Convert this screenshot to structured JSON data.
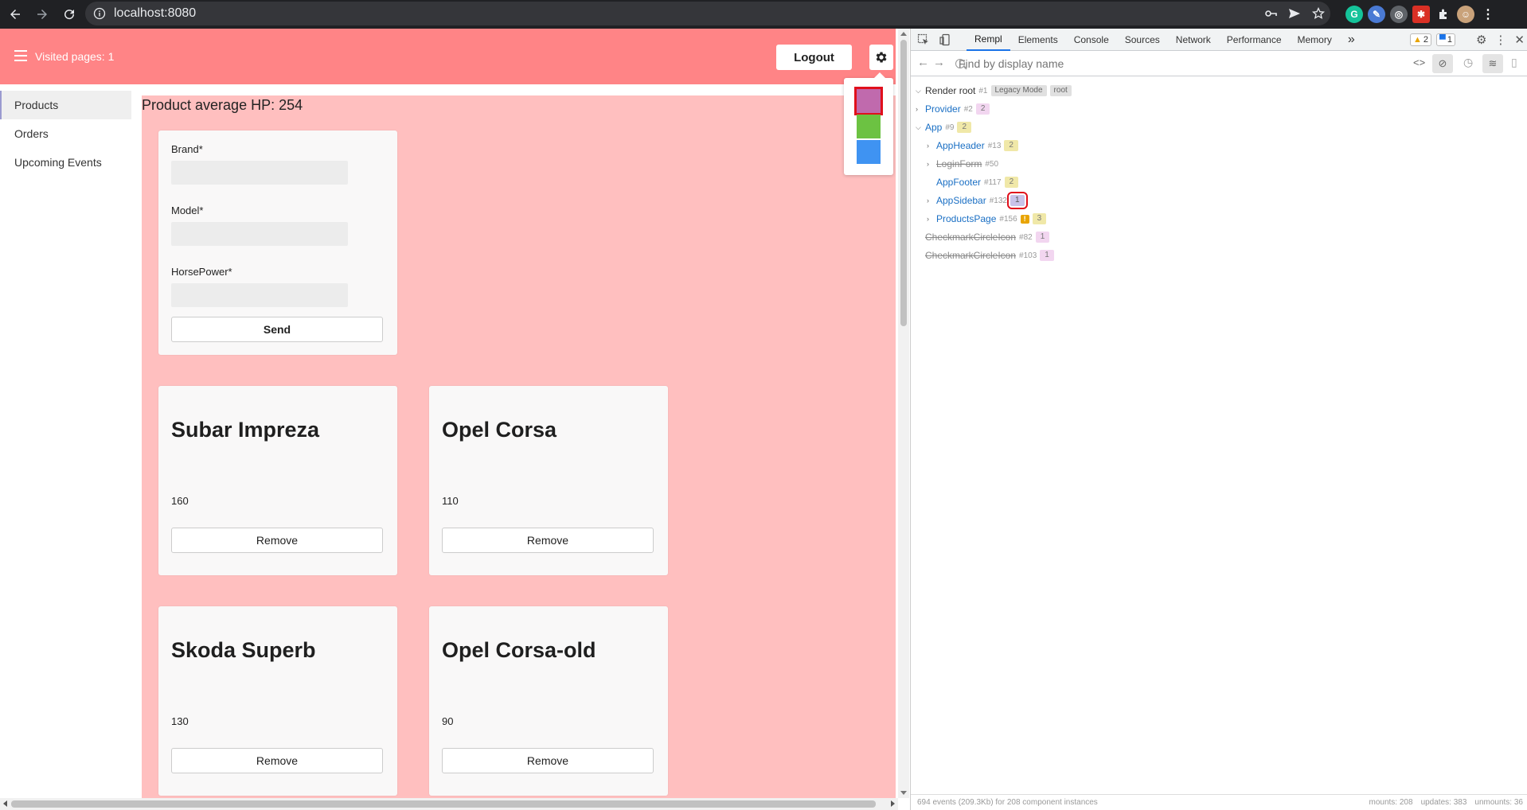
{
  "browser": {
    "url": "localhost:8080"
  },
  "app": {
    "visited_label": "Visited pages: 1",
    "logout_label": "Logout",
    "sidebar": {
      "items": [
        {
          "label": "Products"
        },
        {
          "label": "Orders"
        },
        {
          "label": "Upcoming Events"
        }
      ]
    },
    "average_label": "Product average HP: 254",
    "form": {
      "brand_label": "Brand*",
      "model_label": "Model*",
      "hp_label": "HorsePower*",
      "brand_value": "",
      "model_value": "",
      "hp_value": "",
      "send_label": "Send"
    },
    "products": [
      {
        "name": "Subar Impreza",
        "hp": "160",
        "remove_label": "Remove"
      },
      {
        "name": "Opel Corsa",
        "hp": "110",
        "remove_label": "Remove"
      },
      {
        "name": "Skoda Superb",
        "hp": "130",
        "remove_label": "Remove"
      },
      {
        "name": "Opel Corsa-old",
        "hp": "90",
        "remove_label": "Remove"
      }
    ],
    "theme_colors": [
      {
        "name": "purple",
        "color": "#c06aad",
        "selected": true
      },
      {
        "name": "green",
        "color": "#6cc242",
        "selected": false
      },
      {
        "name": "blue",
        "color": "#3f93f2",
        "selected": false
      }
    ],
    "header_color": "#ff8486",
    "main_color": "#ffbfbf"
  },
  "devtools": {
    "tabs": [
      "Rempl",
      "Elements",
      "Console",
      "Sources",
      "Network",
      "Performance",
      "Memory"
    ],
    "active_tab": "Rempl",
    "more_tabs": "»",
    "warnings_count": "2",
    "messages_count": "1",
    "search_placeholder": "Find by display name",
    "tree": [
      {
        "name": "Render root",
        "id": "#1",
        "tags": [
          "Legacy Mode",
          "root"
        ],
        "kind": "root"
      },
      {
        "name": "Provider",
        "id": "#2",
        "count": "2",
        "count_color": "p"
      },
      {
        "name": "App",
        "id": "#9",
        "count": "2",
        "count_color": "y"
      },
      {
        "name": "AppHeader",
        "id": "#13",
        "count": "2",
        "count_color": "y"
      },
      {
        "name": "LoginForm",
        "id": "#50",
        "dead": true
      },
      {
        "name": "AppFooter",
        "id": "#117",
        "count": "2",
        "count_color": "y"
      },
      {
        "name": "AppSidebar",
        "id": "#132",
        "count": "1",
        "count_color": "b"
      },
      {
        "name": "ProductsPage",
        "id": "#156",
        "warn": "!",
        "count": "3",
        "count_color": "y"
      },
      {
        "name": "CheckmarkCircleIcon",
        "id": "#82",
        "count": "1",
        "count_color": "p",
        "dead": true
      },
      {
        "name": "CheckmarkCircleIcon",
        "id": "#103",
        "count": "1",
        "count_color": "p",
        "dead": true
      }
    ],
    "status_left": "694 events (209.3Kb) for 208 component instances",
    "status_mounts": "mounts: 208",
    "status_updates": "updates: 383",
    "status_unmounts": "unmounts: 36"
  }
}
